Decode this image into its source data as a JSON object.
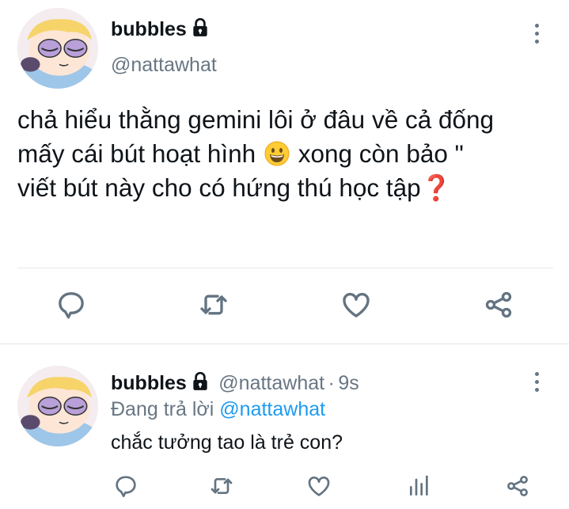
{
  "tweet": {
    "author_name": "bubbles",
    "author_handle": "@nattawhat",
    "lines": [
      "chả hiểu thằng gemini lôi ở đâu về cả đống",
      "mấy cái bút hoạt hình",
      "xong còn bảo \"",
      "viết bút này cho có hứng thú học tập",
      "❓"
    ],
    "emoji": "grinning-face",
    "icons": [
      "reply-icon",
      "retweet-icon",
      "like-icon",
      "share-icon"
    ]
  },
  "reply": {
    "author_name": "bubbles",
    "author_handle": "@nattawhat",
    "separator": "·",
    "time": "9s",
    "replying_prefix": "Đang trả lời",
    "replying_to": "@nattawhat",
    "text": "chắc tưởng tao là trẻ con?",
    "icons": [
      "reply-icon",
      "retweet-icon",
      "like-icon",
      "analytics-icon",
      "share-icon"
    ]
  },
  "colors": {
    "text": "#0f1419",
    "secondary": "#687684",
    "link": "#1d9bf0",
    "icon": "#637381",
    "divider": "#e6e9ec"
  }
}
